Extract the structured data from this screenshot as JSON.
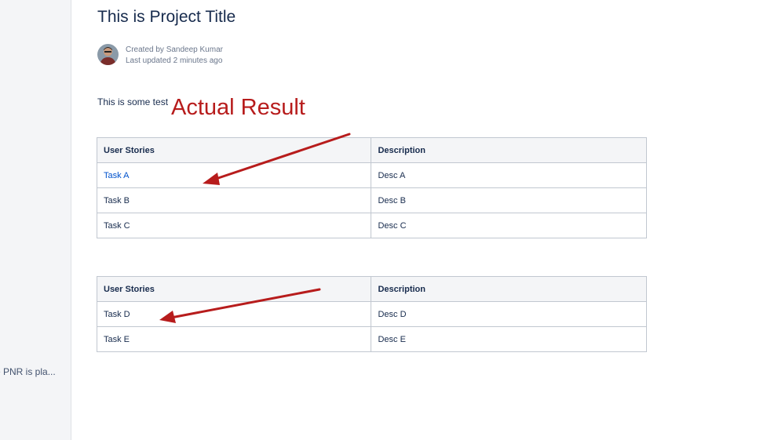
{
  "sidebar": {
    "truncated_item": "e PNR is pla..."
  },
  "page": {
    "title": "This is Project Title",
    "created_by": "Created by Sandeep Kumar",
    "last_updated": "Last updated 2 minutes ago",
    "body_text": "This is some test"
  },
  "annotation": {
    "label": "Actual Result",
    "color": "#b71c1c"
  },
  "tables": [
    {
      "headers": [
        "User Stories",
        "Description"
      ],
      "rows": [
        [
          "Task A",
          "Desc A"
        ],
        [
          "Task B",
          "Desc B"
        ],
        [
          "Task C",
          "Desc C"
        ]
      ]
    },
    {
      "headers": [
        "User Stories",
        "Description"
      ],
      "rows": [
        [
          "Task D",
          "Desc D"
        ],
        [
          "Task E",
          "Desc E"
        ]
      ]
    }
  ],
  "colors": {
    "link": "#0052cc",
    "header_bg": "#f4f5f7",
    "border": "#c1c7d0"
  }
}
